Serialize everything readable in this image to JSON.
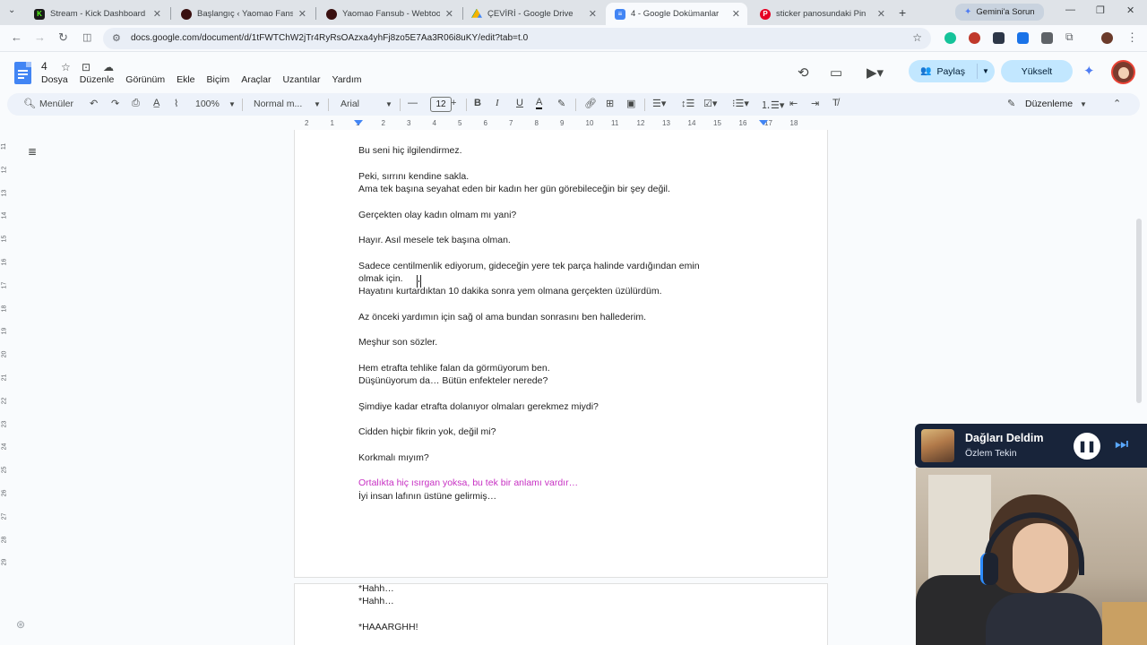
{
  "browser": {
    "tabs": [
      {
        "title": "Stream - Kick Dashboard",
        "icon": "kick-icon",
        "active": false
      },
      {
        "title": "Başlangıç ‹ Yaomao Fansub",
        "icon": "yaomao-icon",
        "active": false
      },
      {
        "title": "Yaomao Fansub - Webtoon",
        "icon": "yaomao-icon",
        "active": false
      },
      {
        "title": "ÇEVİRİ - Google Drive",
        "icon": "drive-icon",
        "active": false
      },
      {
        "title": "4 - Google Dokümanlar",
        "icon": "docs-icon",
        "active": true
      },
      {
        "title": "sticker panosundaki Pin",
        "icon": "pinterest-icon",
        "active": false
      }
    ],
    "gemini_button": "Gemini'a Sorun",
    "url": "docs.google.com/document/d/1tFWTChW2jTr4RyRsOAzxa4yhFj8zo5E7Aa3R06i8uKY/edit?tab=t.0"
  },
  "doc": {
    "title": "4",
    "menu": [
      "Dosya",
      "Düzenle",
      "Görünüm",
      "Ekle",
      "Biçim",
      "Araçlar",
      "Uzantılar",
      "Yardım"
    ],
    "share_label": "Paylaş",
    "upgrade_label": "Yükselt"
  },
  "toolbar": {
    "search_label": "Menüler",
    "zoom": "100%",
    "style": "Normal m...",
    "font": "Arial",
    "font_size": "12",
    "mode_label": "Düzenleme"
  },
  "ruler": {
    "ticks": [
      "2",
      "1",
      "1",
      "2",
      "3",
      "4",
      "5",
      "6",
      "7",
      "8",
      "9",
      "10",
      "11",
      "12",
      "13",
      "14",
      "15",
      "16",
      "17",
      "18"
    ]
  },
  "vruler": {
    "ticks": [
      "11",
      "12",
      "13",
      "14",
      "15",
      "16",
      "17",
      "18",
      "19",
      "20",
      "21",
      "22",
      "23",
      "24",
      "25",
      "26",
      "27",
      "28",
      "29"
    ]
  },
  "page1_lines": [
    {
      "text": "Bu seni hiç ilgilendirmez.",
      "pink": false
    },
    {
      "text": "Peki, sırrını kendine sakla.",
      "pink": false
    },
    {
      "text": "Ama tek başına seyahat eden bir kadın her gün görebileceğin bir şey değil.",
      "pink": false
    },
    {
      "text": "Gerçekten olay kadın olmam mı yani?",
      "pink": false
    },
    {
      "text": "Hayır. Asıl mesele tek başına olman.",
      "pink": false
    },
    {
      "text": "Sadece centilmenlik ediyorum, gideceğin yere tek parça halinde vardığından emin",
      "pink": false
    },
    {
      "text": "olmak için.",
      "pink": false
    },
    {
      "text": "Hayatını kurtardıktan 10 dakika sonra yem olmana gerçekten üzülürdüm.",
      "pink": false
    },
    {
      "text": "Az önceki yardımın için sağ ol ama bundan sonrasını ben hallederim.",
      "pink": false
    },
    {
      "text": "Meşhur son sözler.",
      "pink": false
    },
    {
      "text": "Hem etrafta tehlike falan da görmüyorum ben.",
      "pink": false
    },
    {
      "text": "Düşünüyorum da… Bütün enfekteler nerede?",
      "pink": false
    },
    {
      "text": "Şimdiye kadar etrafta dolanıyor olmaları gerekmez miydi?",
      "pink": false
    },
    {
      "text": "Cidden hiçbir fikrin yok, değil mi?",
      "pink": false
    },
    {
      "text": "Korkmalı mıyım?",
      "pink": false
    },
    {
      "text": "Ortalıkta hiç ısırgan yoksa, bu tek bir anlamı vardır…",
      "pink": true
    },
    {
      "text": "İyi insan lafının üstüne gelirmiş…",
      "pink": false
    }
  ],
  "page2_lines": [
    {
      "text": "*Hahh…"
    },
    {
      "text": "*Hahh…"
    },
    {
      "text": "*HAAARGHH!"
    }
  ],
  "music": {
    "song": "Dağları Deldim",
    "artist": "Özlem Tekin",
    "accent_color": "#18243a"
  }
}
